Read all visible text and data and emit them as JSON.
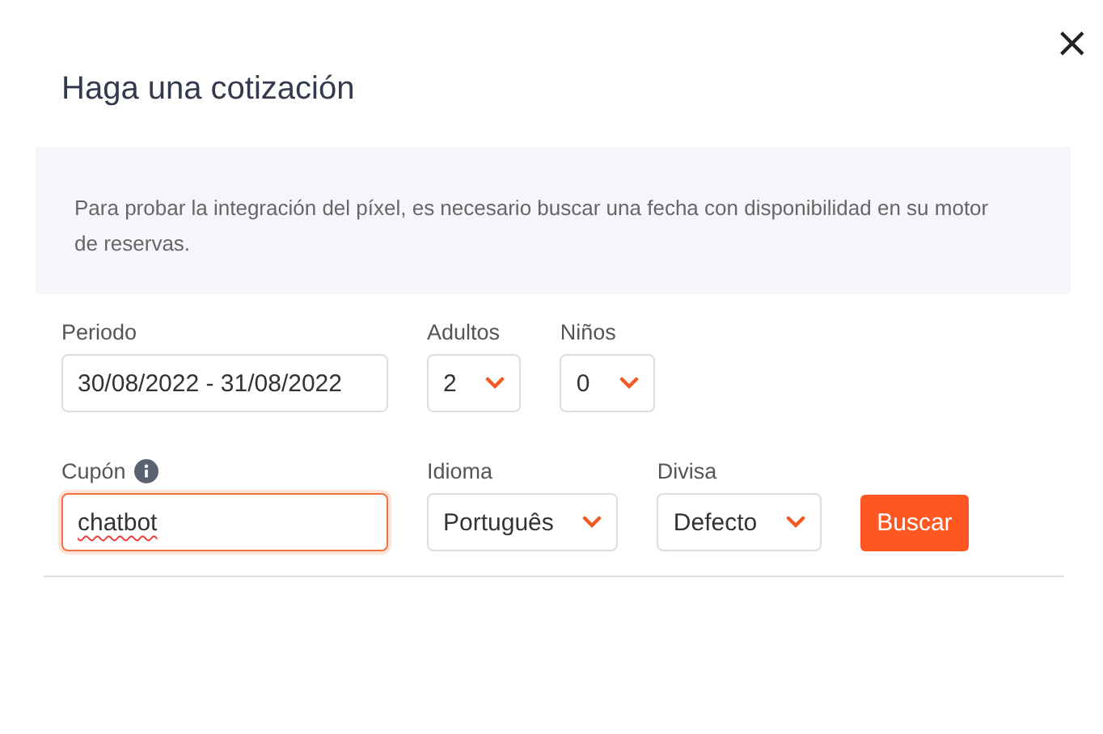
{
  "dialog": {
    "title": "Haga una cotización",
    "close": "×"
  },
  "notice": "Para probar la integración del píxel, es necesario buscar una fecha con disponibilidad en su motor de reservas.",
  "rows": [
    {
      "fields": [
        {
          "kind": "input",
          "label": "Periodo",
          "value": "30/08/2022 - 31/08/2022",
          "focused": false
        },
        {
          "kind": "select",
          "label": "Adultos",
          "value": "2"
        },
        {
          "kind": "select",
          "label": "Niños",
          "value": "0"
        }
      ]
    },
    {
      "fields": [
        {
          "kind": "input",
          "label": "Cupón",
          "value": "chatbot",
          "focused": true,
          "info": true
        },
        {
          "kind": "select",
          "label": "Idioma",
          "value": "Português"
        },
        {
          "kind": "select",
          "label": "Divisa",
          "value": "Defecto"
        }
      ],
      "button": "Buscar"
    }
  ]
}
